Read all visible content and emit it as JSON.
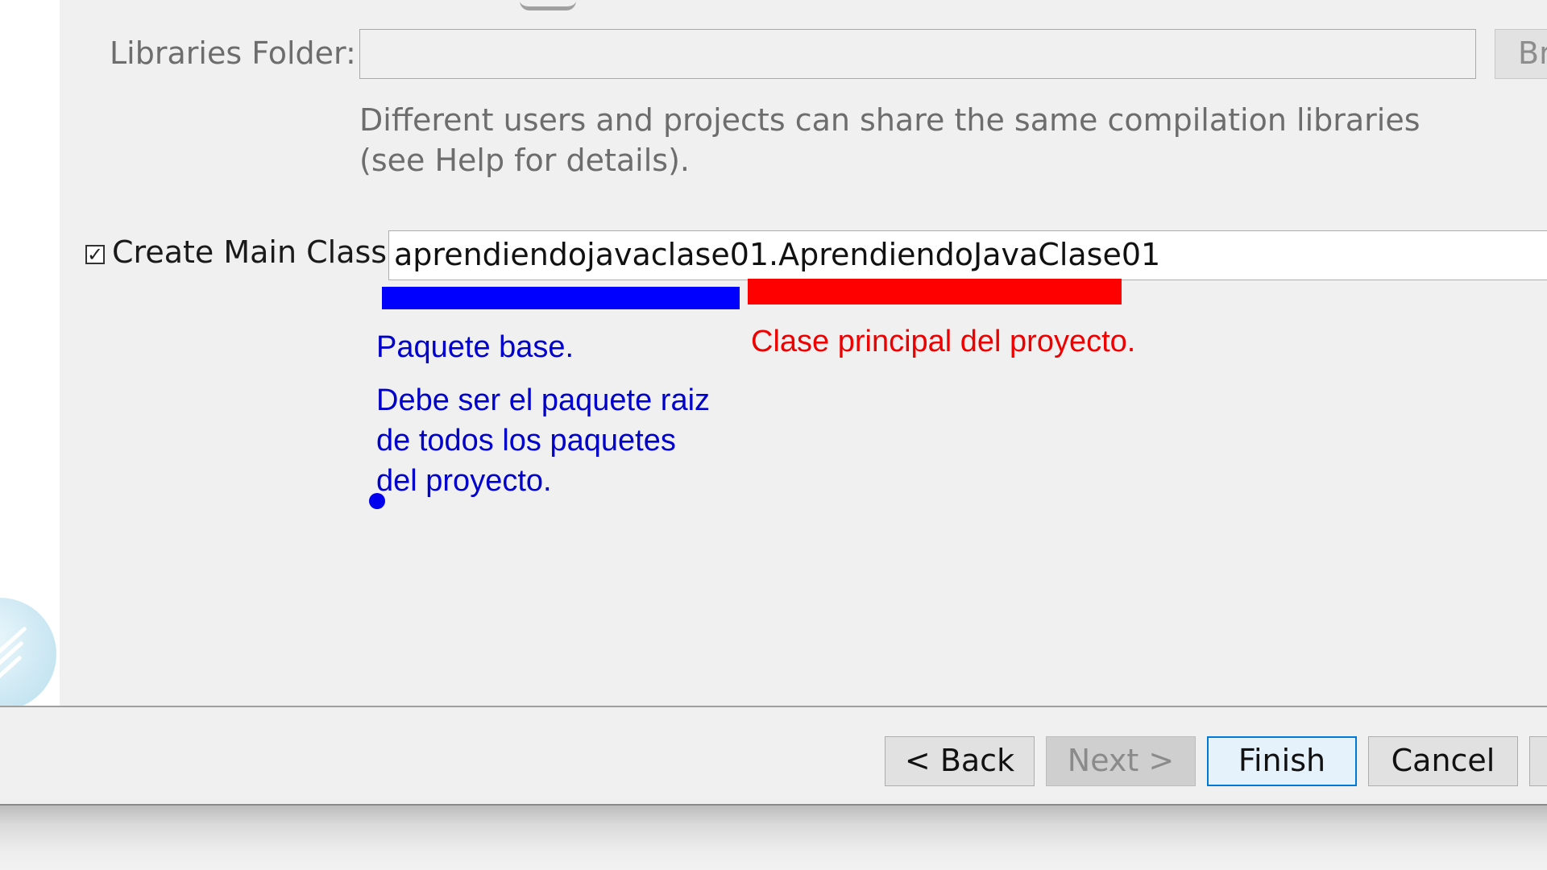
{
  "libraries": {
    "label": "Libraries Folder:",
    "value": "",
    "browse_label": "Br",
    "help_text": "Different users and projects can share the same compilation libraries (see Help for details)."
  },
  "main_class": {
    "checkbox_checked": true,
    "checkbox_glyph": "✓",
    "label": "Create Main Class",
    "value": "aprendiendojavaclase01.AprendiendoJavaClase01"
  },
  "annotations": {
    "blue_color": "#0000ff",
    "red_color": "#ff0000",
    "package_title": "Paquete base.",
    "package_desc_lines": [
      "Debe ser el paquete raiz",
      "de todos los paquetes",
      "del proyecto."
    ],
    "class_note": "Clase principal del proyecto."
  },
  "buttons": {
    "back": "< Back",
    "next": "Next >",
    "finish": "Finish",
    "cancel": "Cancel"
  }
}
